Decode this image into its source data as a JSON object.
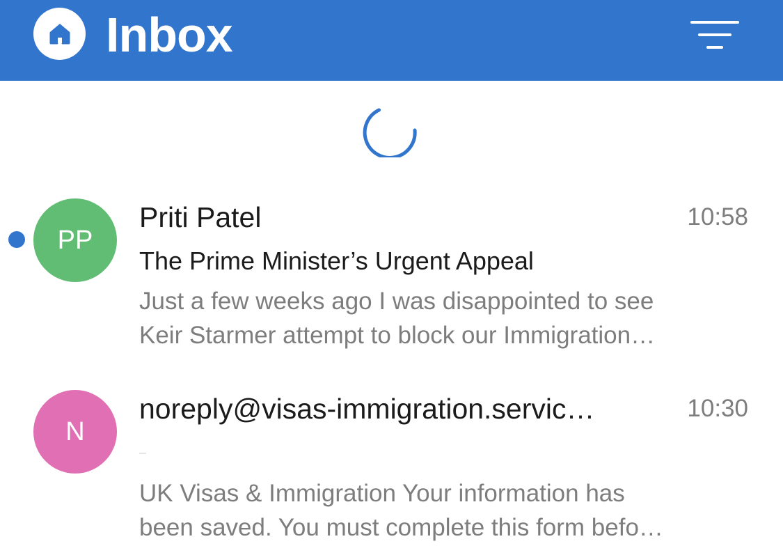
{
  "header": {
    "title": "Inbox",
    "home_icon": "home-icon",
    "filter_icon": "filter-icon",
    "background_color": "#3275cd"
  },
  "status": {
    "loading_icon": "spinner-icon"
  },
  "messages": [
    {
      "initials": "PP",
      "avatar_color": "#62bd74",
      "sender": "Priti Patel",
      "time": "10:58",
      "subject": "The Prime Minister’s Urgent Appeal",
      "preview_lines": [
        "Just a few weeks ago I was disappointed to see",
        "Keir Starmer attempt to block our Immigration…"
      ],
      "unread": true
    },
    {
      "initials": "N",
      "avatar_color": "#e070b3",
      "sender": "noreply@visas-immigration.servic…",
      "time": "10:30",
      "subject": "",
      "preview_lines": [
        "UK Visas & Immigration Your information has",
        "been saved. You must complete this form befo…"
      ],
      "unread": false
    }
  ]
}
